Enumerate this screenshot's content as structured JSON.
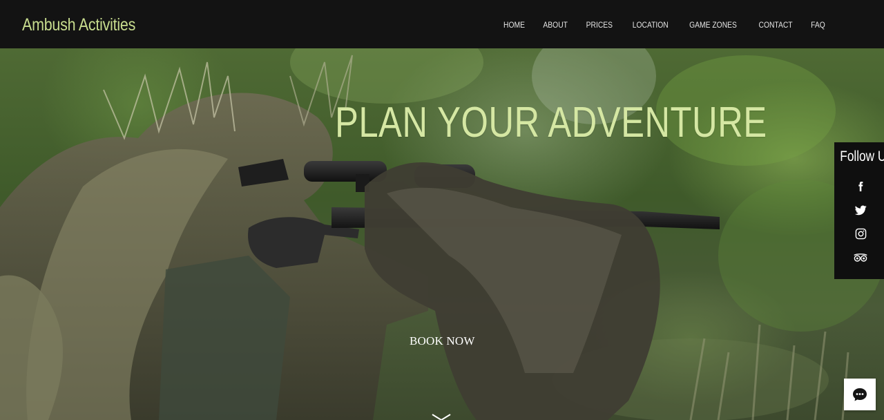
{
  "header": {
    "logo": "Ambush Activities",
    "nav": [
      "HOME",
      "ABOUT",
      "PRICES",
      "LOCATION",
      "GAME ZONES",
      "CONTACT",
      "FAQ"
    ]
  },
  "hero": {
    "title": "PLAN YOUR ADVENTURE",
    "cta_label": "BOOK NOW",
    "scroll_icon": "chevron-down-icon"
  },
  "social": {
    "title": "Follow Us",
    "icons": [
      "facebook-icon",
      "twitter-icon",
      "instagram-icon",
      "tripadvisor-icon"
    ]
  },
  "chat": {
    "icon": "chat-bubble-icon"
  },
  "colors": {
    "header_bg": "#131313",
    "accent": "#c7dc8e",
    "hero_title": "#d5e7a3",
    "panel_bg": "#0f0f0f"
  }
}
